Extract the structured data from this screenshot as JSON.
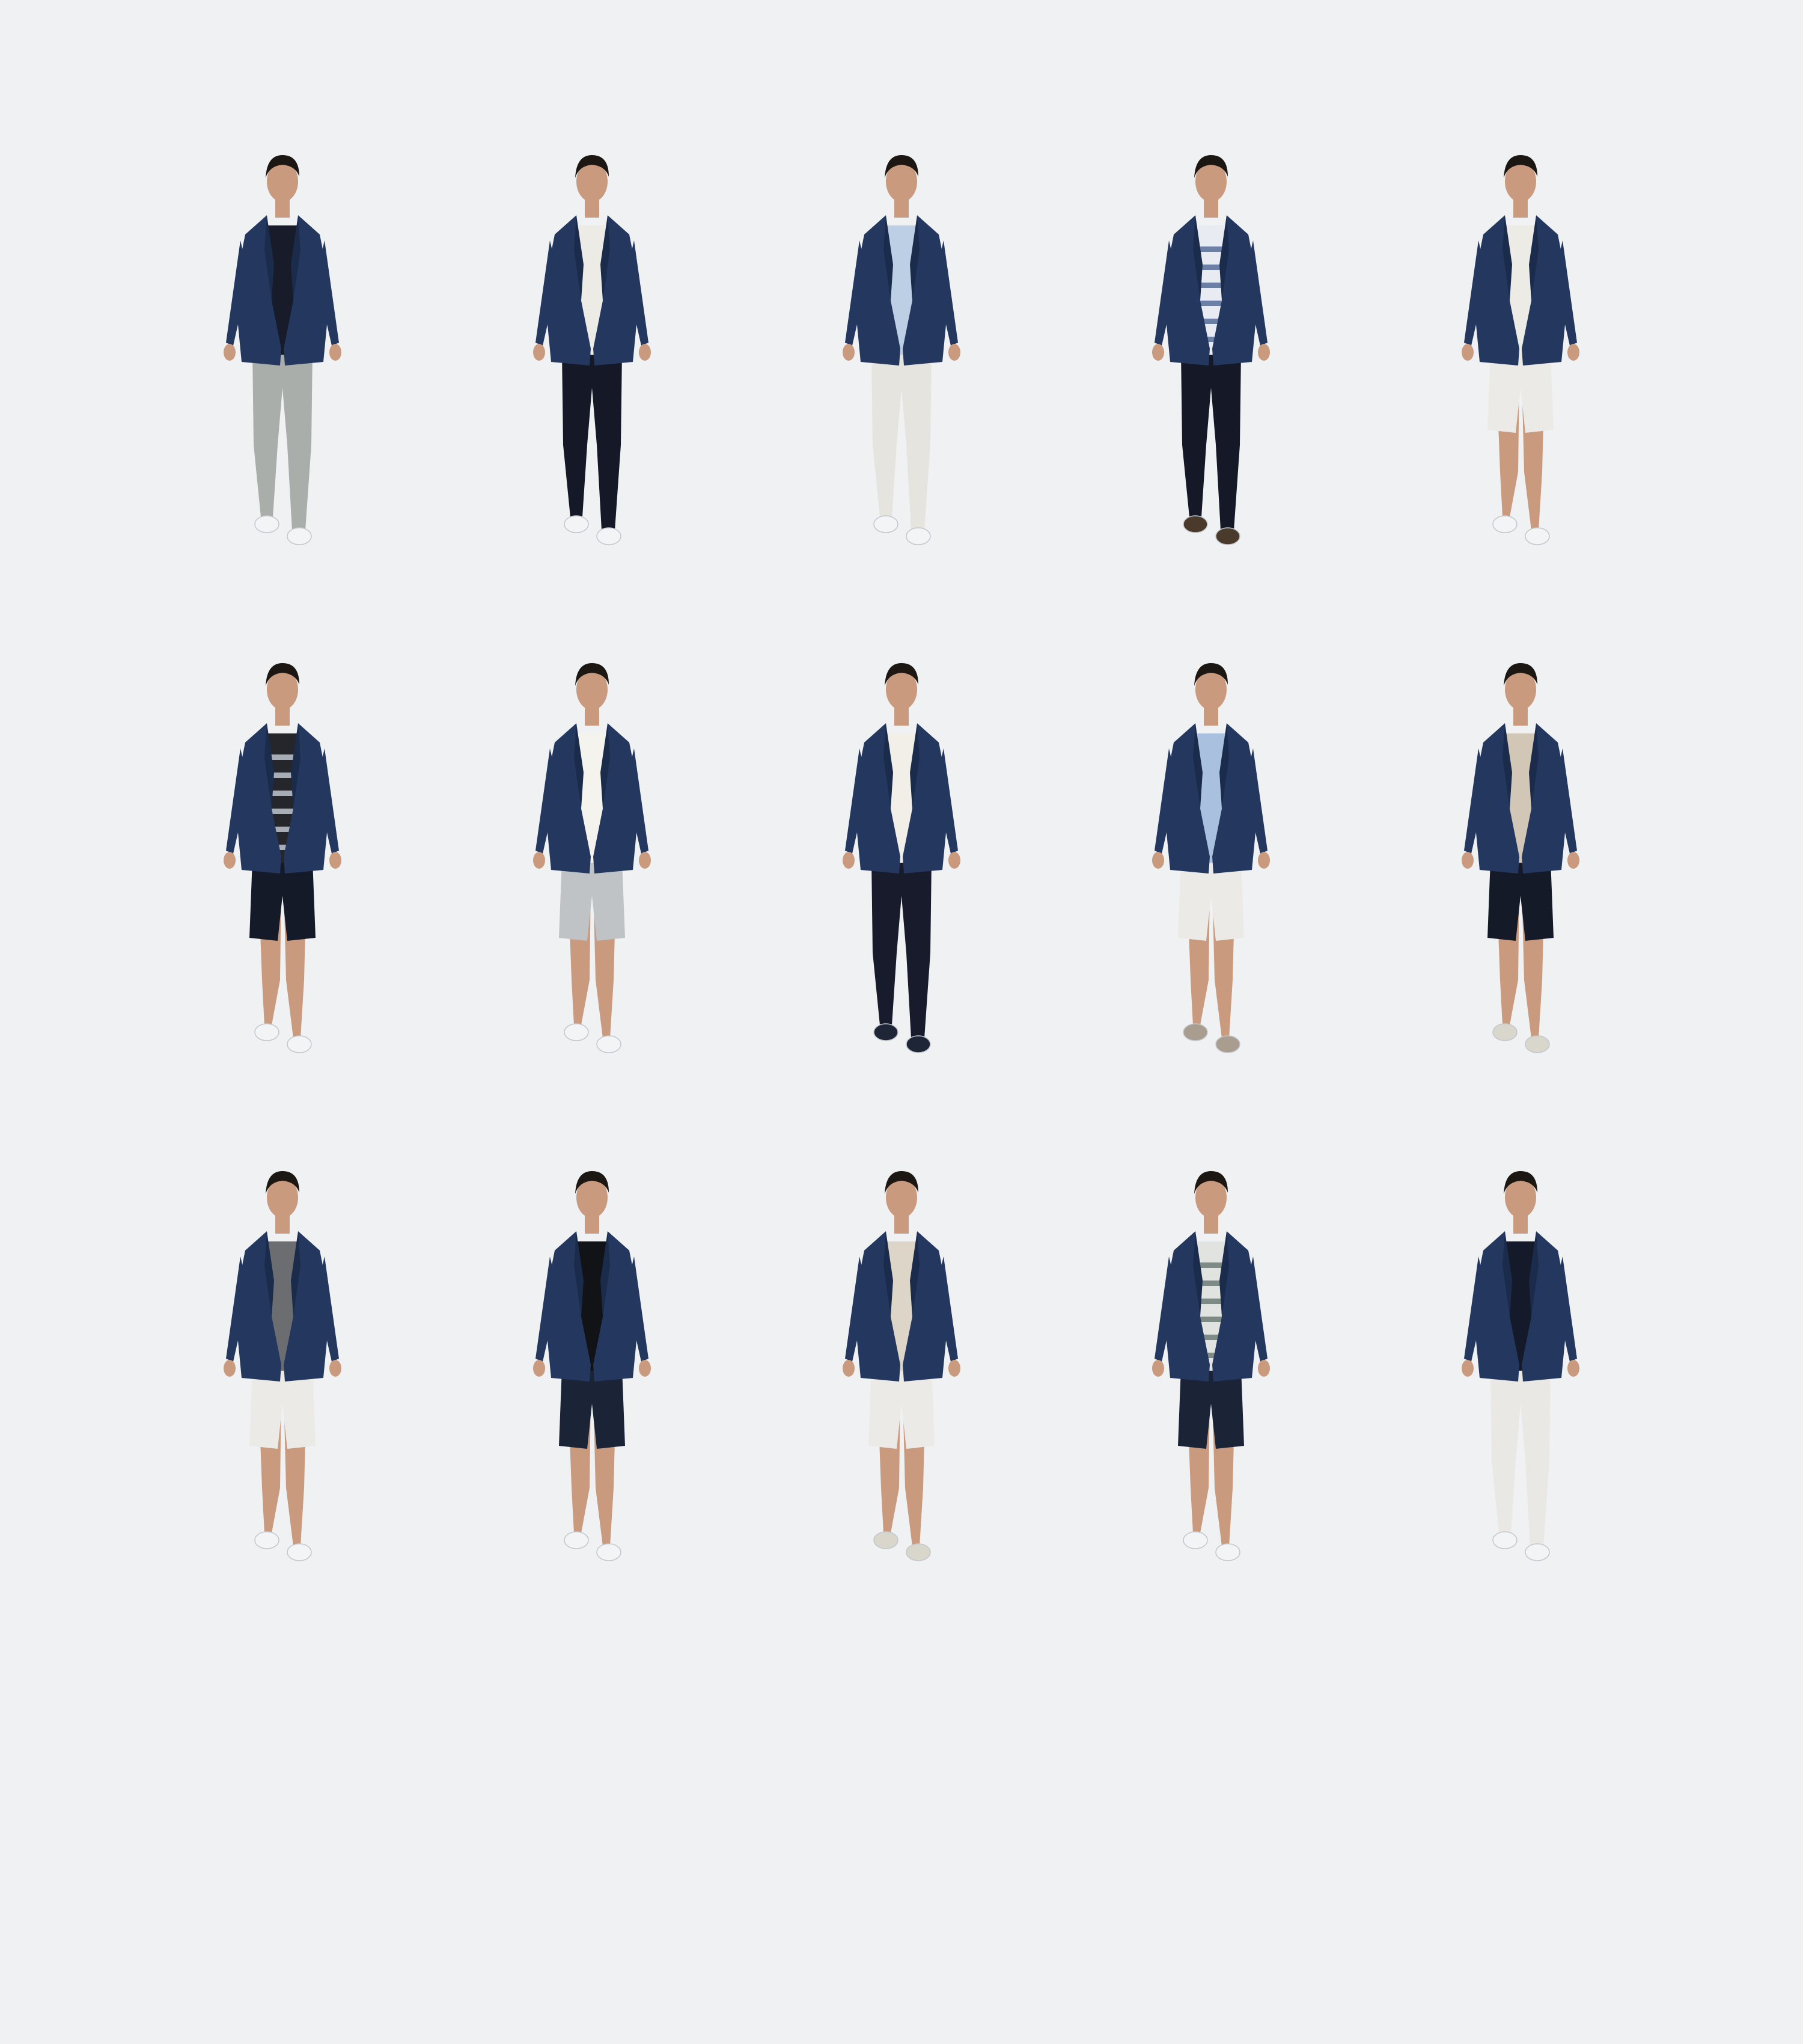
{
  "palette": {
    "background": "#eff1f3",
    "blazer": "#24385f",
    "blazer_shade": "#1b2b4b",
    "skin": "#c99a7d",
    "hair": "#1d1713"
  },
  "looks": [
    {
      "name": "look-1",
      "top": "#171b2a",
      "stripe": null,
      "bottom": "#a9aeaa",
      "shorts": false,
      "shoes": "#f3f4f5"
    },
    {
      "name": "look-2",
      "top": "#ecebe5",
      "stripe": null,
      "bottom": "#141827",
      "shorts": false,
      "shoes": "#f3f4f5"
    },
    {
      "name": "look-3",
      "top": "#bccfe4",
      "stripe": null,
      "bottom": "#e5e4de",
      "shorts": false,
      "shoes": "#f3f4f5"
    },
    {
      "name": "look-4",
      "top": "#e8ebf2",
      "stripe": "#6d7fa5",
      "bottom": "#141827",
      "shorts": false,
      "shoes": "#4a3a2c"
    },
    {
      "name": "look-5",
      "top": "#ecebe5",
      "stripe": null,
      "bottom": "#ebeae6",
      "shorts": true,
      "shoes": "#f3f4f5"
    },
    {
      "name": "look-6",
      "top": "#24262b",
      "stripe": "#a7adb6",
      "bottom": "#151a29",
      "shorts": true,
      "shoes": "#f3f4f5"
    },
    {
      "name": "look-7",
      "top": "#f4f3ee",
      "stripe": null,
      "bottom": "#bfc3c6",
      "shorts": true,
      "shoes": "#f3f4f5"
    },
    {
      "name": "look-8",
      "top": "#f1efe8",
      "stripe": null,
      "bottom": "#171b2b",
      "shorts": false,
      "shoes": "#1e2537"
    },
    {
      "name": "look-9",
      "top": "#a9c0de",
      "stripe": null,
      "bottom": "#ebeae6",
      "shorts": true,
      "shoes": "#a89d8f"
    },
    {
      "name": "look-10",
      "top": "#d2c6b6",
      "stripe": null,
      "bottom": "#151a29",
      "shorts": true,
      "shoes": "#d9d6cc"
    },
    {
      "name": "look-11",
      "top": "#6c6d70",
      "stripe": null,
      "bottom": "#ebeae6",
      "shorts": true,
      "shoes": "#f3f4f5"
    },
    {
      "name": "look-12",
      "top": "#121317",
      "stripe": null,
      "bottom": "#1b2437",
      "shorts": true,
      "shoes": "#f3f4f5"
    },
    {
      "name": "look-13",
      "top": "#ddd5c8",
      "stripe": null,
      "bottom": "#ebeae6",
      "shorts": true,
      "shoes": "#d9d6cc"
    },
    {
      "name": "look-14",
      "top": "#e1e3e0",
      "stripe": "#7d8a86",
      "bottom": "#1b2437",
      "shorts": true,
      "shoes": "#f3f4f5"
    },
    {
      "name": "look-15",
      "top": "#151a2b",
      "stripe": null,
      "bottom": "#e9e8e4",
      "shorts": false,
      "shoes": "#f3f4f5"
    }
  ]
}
